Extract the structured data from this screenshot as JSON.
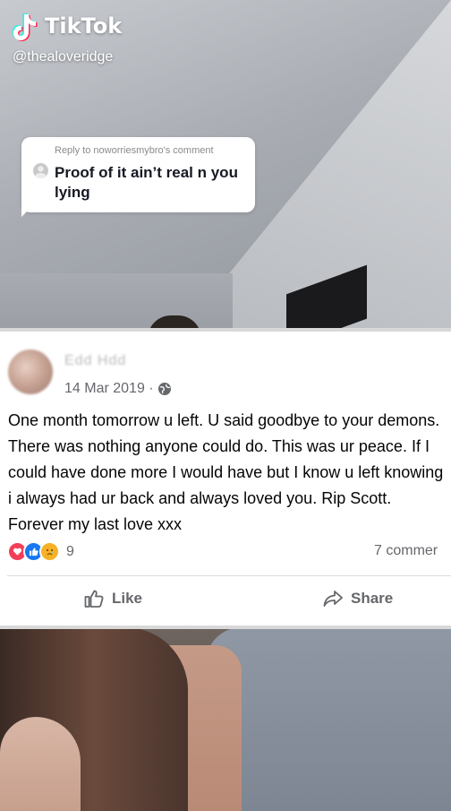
{
  "watermark": {
    "brand": "TikTok",
    "handle": "@thealoveridge"
  },
  "reply_bubble": {
    "header": "Reply to noworriesmybro's comment",
    "text": "Proof of it ain’t real n you lying"
  },
  "post": {
    "author": "Edd Hdd",
    "date": "14 Mar 2019 ·",
    "text": "One month tomorrow u left. U said goodbye to your demons. There was nothing anyone could do. This was ur peace. If I could have done more I would have but I know u left knowing i always had ur back and always loved you. Rip Scott. Forever my last love xxx",
    "reaction_count": "9",
    "comments_label": "7 commer",
    "actions": {
      "like": "Like",
      "share": "Share"
    }
  },
  "colors": {
    "facebook_blue": "#1877f2",
    "love_red": "#f33e58",
    "sad_yellow": "#f7b125",
    "tiktok_cyan": "#25f4ee",
    "tiktok_red": "#fe2c55"
  }
}
